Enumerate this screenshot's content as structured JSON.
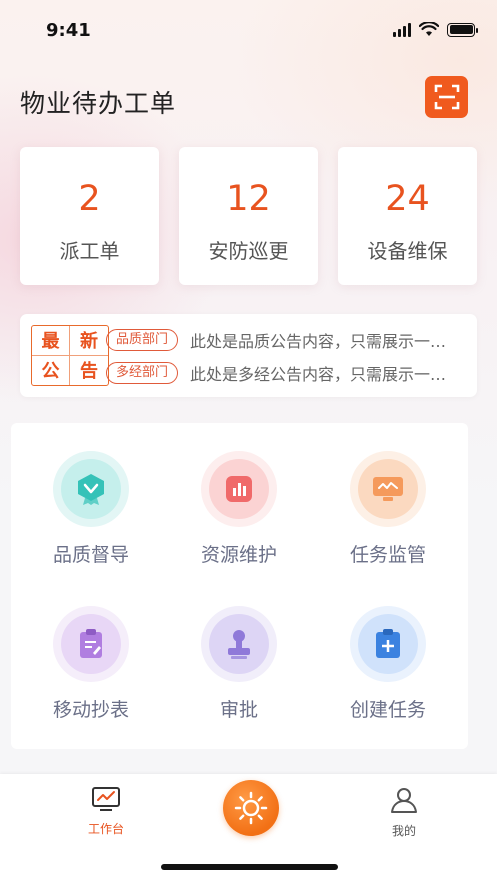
{
  "status": {
    "time": "9:41"
  },
  "header": {
    "title": "物业待办工单",
    "scan_icon": "scan-icon",
    "accent": "#f05a1e"
  },
  "stats": [
    {
      "value": "2",
      "label": "派工单"
    },
    {
      "value": "12",
      "label": "安防巡更"
    },
    {
      "value": "24",
      "label": "设备维保"
    }
  ],
  "notice": {
    "badge": [
      "最",
      "新",
      "公",
      "告"
    ],
    "items": [
      {
        "tag": "品质部门",
        "text": "此处是品质公告内容，只需展示一行..."
      },
      {
        "tag": "多经部门",
        "text": "此处是多经公告内容，只需展示一行..."
      }
    ]
  },
  "grid": [
    {
      "label": "品质督导",
      "icon": "badge-check-icon",
      "outer": "#e3f6f5",
      "inner": "#c5efec",
      "color": "#35c2b8"
    },
    {
      "label": "资源维护",
      "icon": "bar-chart-icon",
      "outer": "#fdeeee",
      "inner": "#fbd3d3",
      "color": "#f06a6a"
    },
    {
      "label": "任务监管",
      "icon": "monitor-icon",
      "outer": "#fdf0e6",
      "inner": "#fbd9c0",
      "color": "#f59a5c"
    },
    {
      "label": "移动抄表",
      "icon": "clipboard-edit-icon",
      "outer": "#f5eefa",
      "inner": "#e8d7f6",
      "color": "#b07ee0"
    },
    {
      "label": "审批",
      "icon": "stamp-icon",
      "outer": "#f1eefa",
      "inner": "#ddd5f5",
      "color": "#8f79d9"
    },
    {
      "label": "创建任务",
      "icon": "clipboard-plus-icon",
      "outer": "#eaf2fd",
      "inner": "#d0e2fb",
      "color": "#3b82e0"
    }
  ],
  "tabbar": {
    "tabs": [
      {
        "label": "工作台",
        "icon": "dashboard-icon",
        "active": true
      },
      {
        "label": "我的",
        "icon": "user-icon",
        "active": false
      }
    ],
    "active_color": "#e8531f",
    "inactive_color": "#555555"
  }
}
